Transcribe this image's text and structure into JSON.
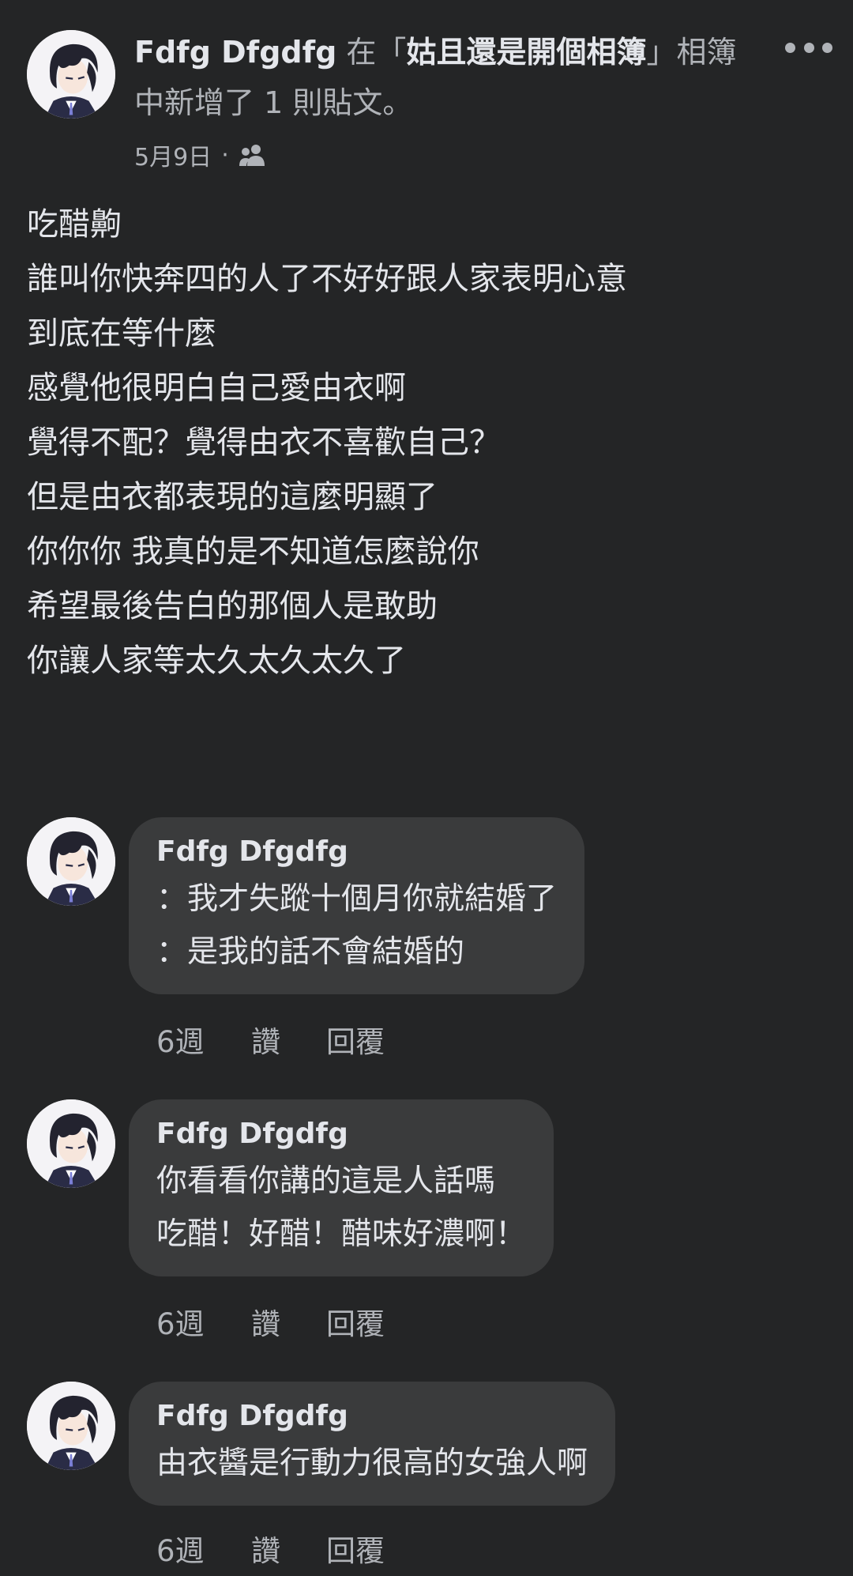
{
  "post": {
    "author": "Fdfg Dfgdfg",
    "action_prefix": " 在「",
    "album": "姑且還是開個相簿",
    "action_suffix": "」相簿中新增了 1 則貼文。",
    "date": "5月9日",
    "separator": "·",
    "audience_icon": "friends-icon",
    "more_icon": "more-horizontal-icon",
    "lines": [
      "吃醋齁",
      "誰叫你快奔四的人了不好好跟人家表明心意",
      "到底在等什麼",
      "感覺他很明白自己愛由衣啊",
      "覺得不配？覺得由衣不喜歡自己？",
      "但是由衣都表現的這麼明顯了",
      "你你你 我真的是不知道怎麼說你",
      "希望最後告白的那個人是敢助",
      "你讓人家等太久太久太久了"
    ]
  },
  "comments": [
    {
      "author": "Fdfg Dfgdfg",
      "lines": [
        "：我才失蹤十個月你就結婚了",
        "：是我的話不會結婚的"
      ],
      "time": "6週",
      "like_label": "讚",
      "reply_label": "回覆"
    },
    {
      "author": "Fdfg Dfgdfg",
      "lines": [
        "你看看你講的這是人話嗎",
        "吃醋！好醋！醋味好濃啊！"
      ],
      "time": "6週",
      "like_label": "讚",
      "reply_label": "回覆"
    },
    {
      "author": "Fdfg Dfgdfg",
      "lines": [
        "由衣醬是行動力很高的女強人啊"
      ],
      "time": "6週",
      "like_label": "讚",
      "reply_label": "回覆"
    }
  ],
  "colors": {
    "background": "#242526",
    "bubble": "#3a3b3c",
    "primary_text": "#e4e6eb",
    "secondary_text": "#b0b3b8"
  }
}
